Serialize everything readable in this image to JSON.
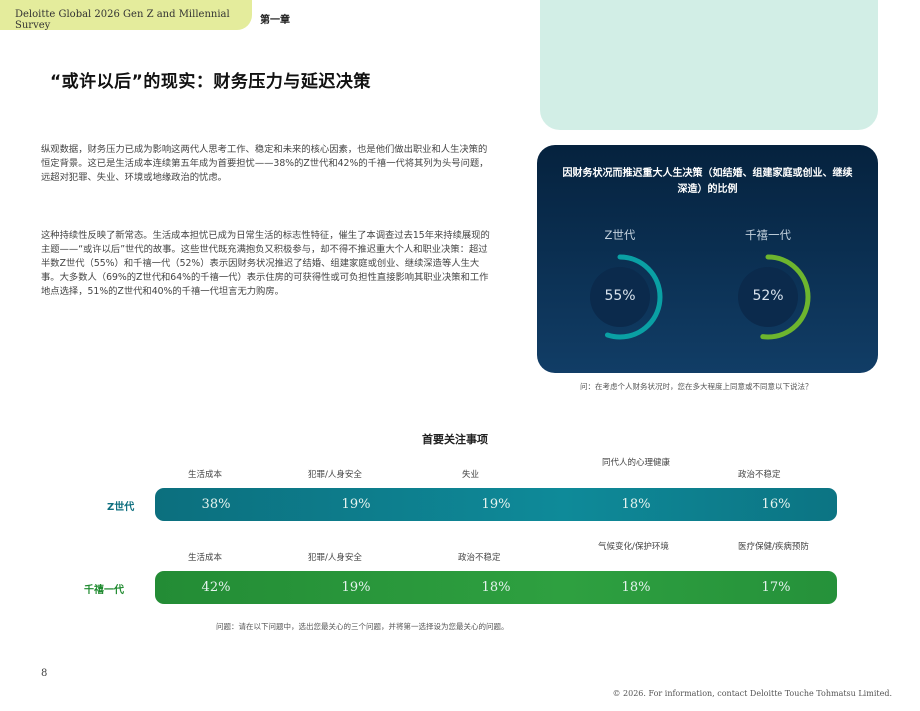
{
  "header": {
    "survey_title": "Deloitte Global 2026 Gen Z and Millennial Survey",
    "chapter": "第一章"
  },
  "headline": "“或许以后”的现实：财务压力与延迟决策",
  "paragraphs": {
    "p1": "纵观数据，财务压力已成为影响这两代人思考工作、稳定和未来的核心因素，也是他们做出职业和人生决策的恒定背景。这已是生活成本连续第五年成为首要担忧——38%的Z世代和42%的千禧一代将其列为头号问题，远超对犯罪、失业、环境或地缘政治的忧虑。",
    "p2": "这种持续性反映了新常态。生活成本担忧已成为日常生活的标志性特征，催生了本调查过去15年来持续展现的主题——“或许以后”世代的故事。这些世代既充满抱负又积极参与，却不得不推迟重大个人和职业决策：超过半数Z世代（55%）和千禧一代（52%）表示因财务状况推迟了结婚、组建家庭或创业、继续深造等人生大事。大多数人（69%的Z世代和64%的千禧一代）表示住房的可获得性或可负担性直接影响其职业决策和工作地点选择，51%的Z世代和40%的千禧一代坦言无力购房。"
  },
  "panel": {
    "title": "因财务状况而推迟重大人生决策（如结婚、组建家庭或创业、继续深造）的比例",
    "rings": [
      {
        "label": "Z世代",
        "value": 55,
        "value_text": "55%",
        "color": "#0aa0a4"
      },
      {
        "label": "千禧一代",
        "value": 52,
        "value_text": "52%",
        "color": "#6db52e"
      }
    ],
    "question": "问：在考虑个人财务状况时，您在多大程度上同意或不同意以下说法？"
  },
  "concerns": {
    "title": "首要关注事项",
    "gen_z": {
      "label": "Z世代",
      "categories": [
        "生活成本",
        "犯罪/人身安全",
        "失业",
        "同代人的心理健康",
        "政治不稳定"
      ],
      "values": [
        "38%",
        "19%",
        "19%",
        "18%",
        "16%"
      ]
    },
    "millennial": {
      "label": "千禧一代",
      "categories": [
        "生活成本",
        "犯罪/人身安全",
        "政治不稳定",
        "气候变化/保护环境",
        "医疗保健/疾病预防"
      ],
      "values": [
        "42%",
        "19%",
        "18%",
        "18%",
        "17%"
      ]
    },
    "question": "问题：请在以下问题中，选出您最关心的三个问题，并将第一选择设为您最关心的问题。"
  },
  "colors": {
    "teal": "#0e8a99",
    "green": "#2ea040",
    "navy": "#05223e",
    "tab": "#e4ec9c",
    "mint": "#d2eee6"
  },
  "page_number": "8",
  "footer": "© 2026. For information, contact Deloitte Touche Tohmatsu Limited."
}
